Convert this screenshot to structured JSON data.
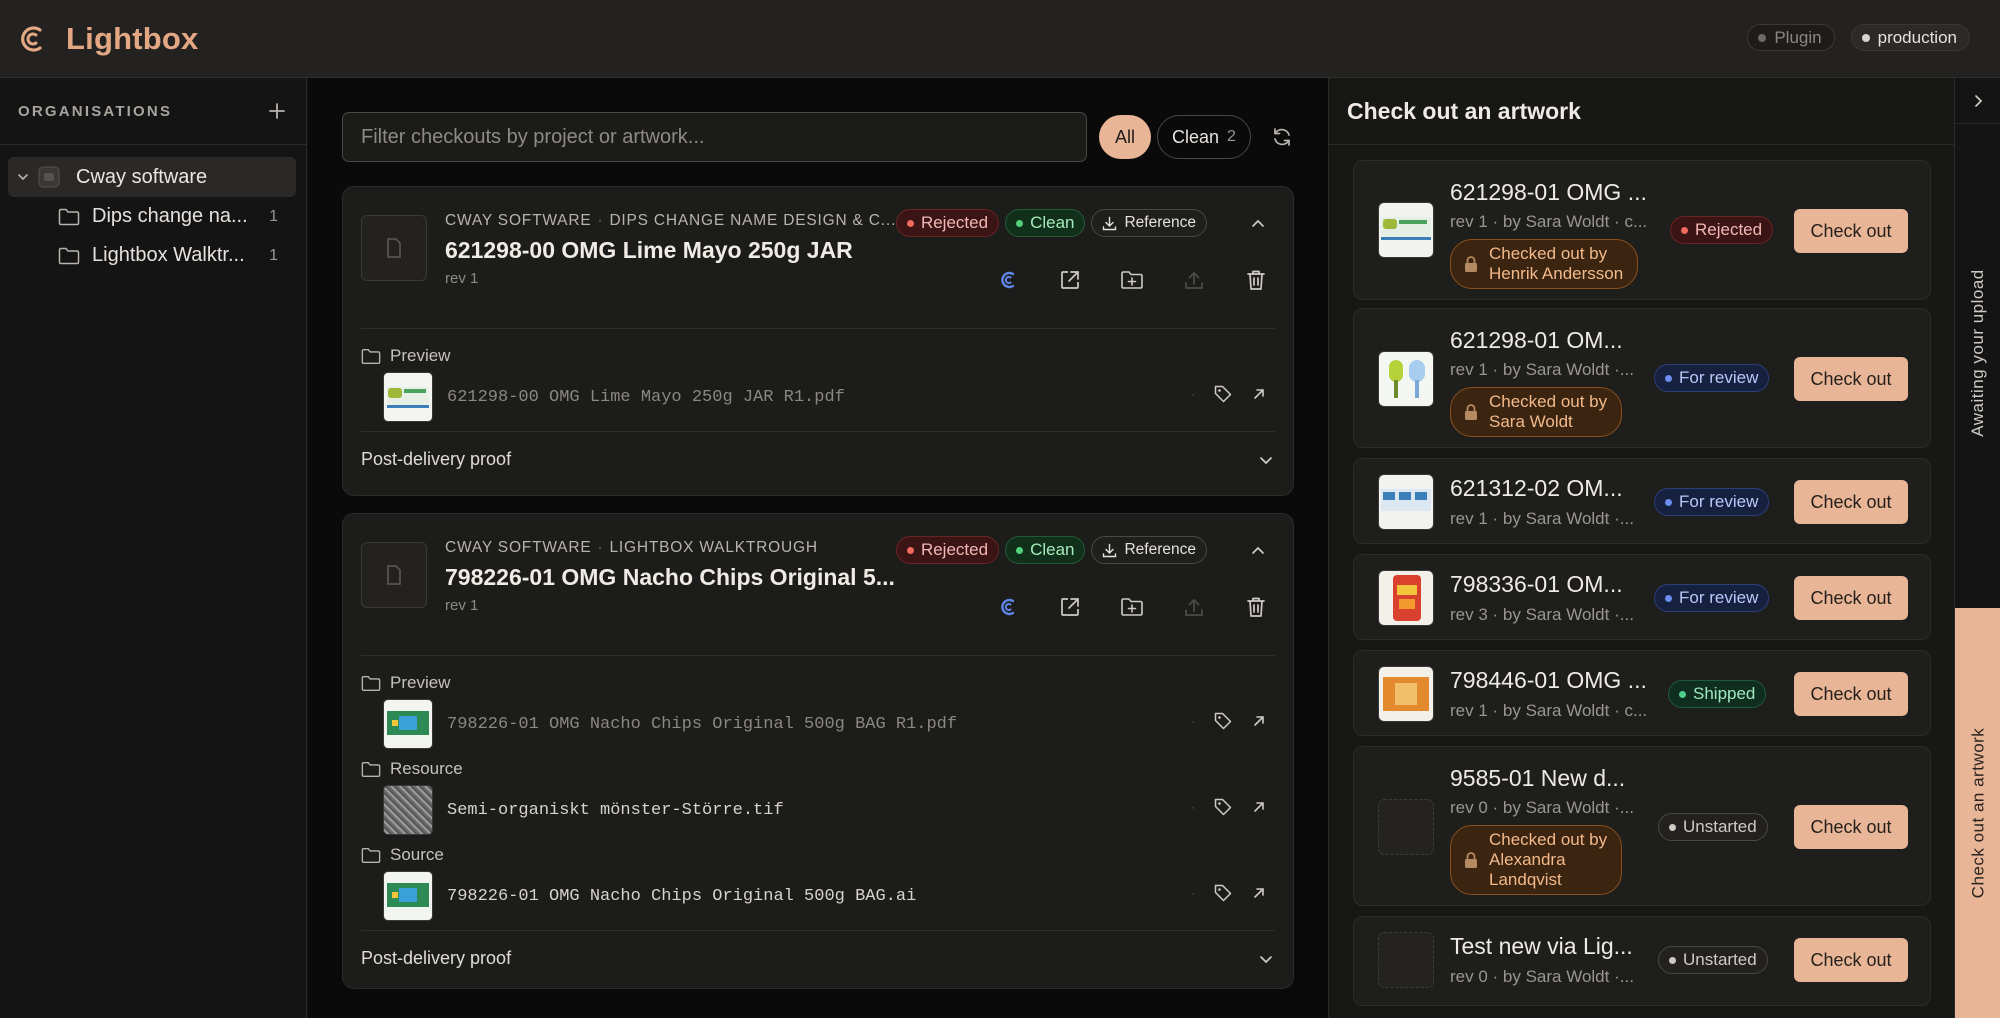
{
  "app": {
    "name": "Lightbox"
  },
  "env": {
    "plugin": "Plugin",
    "production": "production"
  },
  "sidebar": {
    "title": "ORGANISATIONS",
    "root": "Cway software",
    "items": [
      {
        "label": "Dips change na...",
        "count": "1"
      },
      {
        "label": "Lightbox Walktr...",
        "count": "1"
      }
    ]
  },
  "filter": {
    "placeholder": "Filter checkouts by project or artwork...",
    "all": "All",
    "clean": "Clean",
    "clean_count": "2"
  },
  "checkouts": [
    {
      "org": "CWAY SOFTWARE",
      "project": "DIPS CHANGE NAME DESIGN & C...",
      "title": "621298-00 OMG Lime Mayo 250g JAR",
      "rev": "rev 1",
      "status": "Rejected",
      "clean": "Clean",
      "reference": "Reference",
      "sections": [
        {
          "label": "Preview",
          "files": [
            {
              "name": "621298-00 OMG Lime Mayo 250g JAR R1.pdf"
            }
          ]
        }
      ],
      "proof": "Post-delivery proof"
    },
    {
      "org": "CWAY SOFTWARE",
      "project": "LIGHTBOX WALKTROUGH",
      "title": "798226-01 OMG Nacho Chips Original 5...",
      "rev": "rev 1",
      "status": "Rejected",
      "clean": "Clean",
      "reference": "Reference",
      "sections": [
        {
          "label": "Preview",
          "files": [
            {
              "name": "798226-01 OMG Nacho Chips Original 500g BAG R1.pdf"
            }
          ]
        },
        {
          "label": "Resource",
          "files": [
            {
              "name": "Semi-organiskt mönster-Större.tif"
            }
          ]
        },
        {
          "label": "Source",
          "files": [
            {
              "name": "798226-01 OMG Nacho Chips Original 500g BAG.ai"
            }
          ]
        }
      ],
      "proof": "Post-delivery proof"
    }
  ],
  "panel": {
    "title": "Check out an artwork",
    "button": "Check out",
    "artworks": [
      {
        "title": "621298-01 OMG ...",
        "meta": "rev 1 · by Sara Woldt · c...",
        "status": "Rejected",
        "lock": [
          "Checked out by",
          "Henrik Andersson"
        ]
      },
      {
        "title": "621298-01 OM...",
        "meta": "rev 1 · by Sara Woldt ·...",
        "status": "For review",
        "lock": [
          "Checked out by",
          "Sara Woldt"
        ]
      },
      {
        "title": "621312-02 OM...",
        "meta": "rev 1 · by Sara Woldt ·...",
        "status": "For review"
      },
      {
        "title": "798336-01 OM...",
        "meta": "rev 3 · by Sara Woldt ·...",
        "status": "For review"
      },
      {
        "title": "798446-01 OMG ...",
        "meta": "rev 1 · by Sara Woldt · c...",
        "status": "Shipped"
      },
      {
        "title": "9585-01 New d...",
        "meta": "rev 0 · by Sara Woldt ·...",
        "status": "Unstarted",
        "lock": [
          "Checked out by",
          "Alexandra",
          "Landqvist"
        ]
      },
      {
        "title": "Test new via Lig...",
        "meta": "rev 0 · by Sara Woldt ·...",
        "status": "Unstarted"
      }
    ]
  },
  "rail": {
    "awaiting": "Awaiting your upload",
    "checkout": "Check out an artwork"
  },
  "colors": {
    "accent": "#e8b596",
    "rejected": "#f06a5d",
    "clean": "#53d07b",
    "review": "#6b8ef0",
    "shipped": "#4fd08c"
  }
}
